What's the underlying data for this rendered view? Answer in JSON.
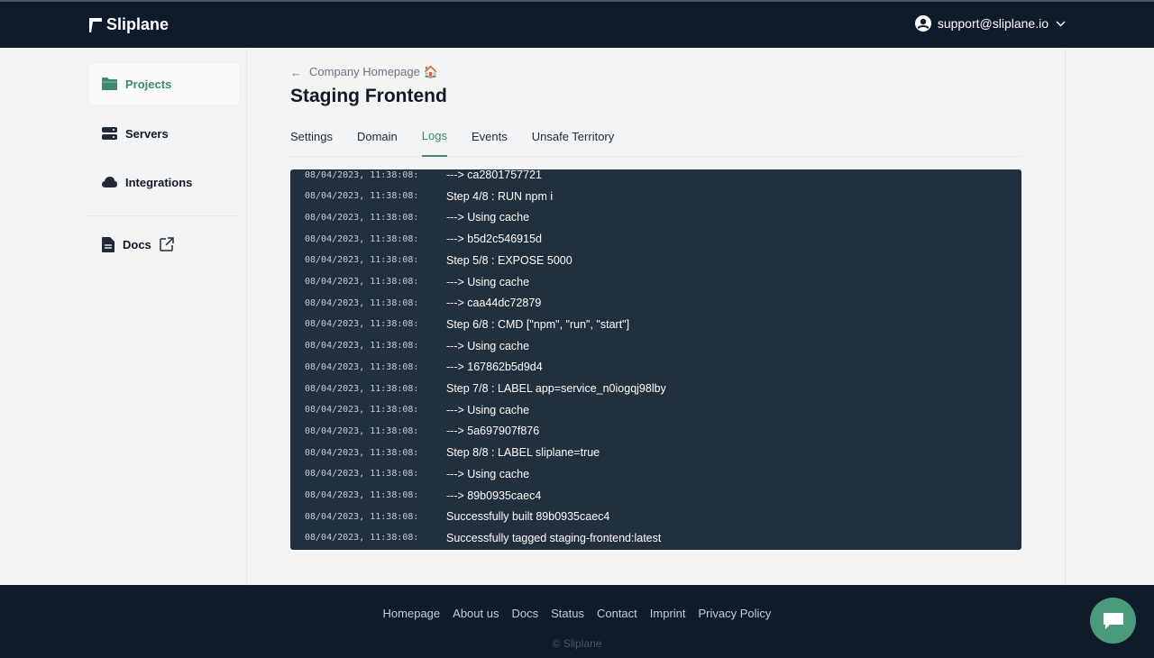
{
  "header": {
    "brand": "Sliplane",
    "user_email": "support@sliplane.io"
  },
  "sidebar": {
    "items": [
      {
        "label": "Projects",
        "icon": "folder-icon",
        "active": true
      },
      {
        "label": "Servers",
        "icon": "server-icon",
        "active": false
      },
      {
        "label": "Integrations",
        "icon": "cloud-icon",
        "active": false
      }
    ],
    "docs": {
      "label": "Docs",
      "icon": "document-icon"
    }
  },
  "main": {
    "breadcrumb": "Company Homepage 🏠",
    "title": "Staging Frontend",
    "tabs": [
      {
        "label": "Settings",
        "active": false
      },
      {
        "label": "Domain",
        "active": false
      },
      {
        "label": "Logs",
        "active": true
      },
      {
        "label": "Events",
        "active": false
      },
      {
        "label": "Unsafe Territory",
        "active": false
      }
    ],
    "logs": [
      {
        "ts": "08/04/2023, 11:38:08:",
        "msg": "---> ca2801757721"
      },
      {
        "ts": "08/04/2023, 11:38:08:",
        "msg": "Step 4/8 : RUN npm i"
      },
      {
        "ts": "08/04/2023, 11:38:08:",
        "msg": "---> Using cache"
      },
      {
        "ts": "08/04/2023, 11:38:08:",
        "msg": "---> b5d2c546915d"
      },
      {
        "ts": "08/04/2023, 11:38:08:",
        "msg": "Step 5/8 : EXPOSE 5000"
      },
      {
        "ts": "08/04/2023, 11:38:08:",
        "msg": "---> Using cache"
      },
      {
        "ts": "08/04/2023, 11:38:08:",
        "msg": "---> caa44dc72879"
      },
      {
        "ts": "08/04/2023, 11:38:08:",
        "msg": "Step 6/8 : CMD [\"npm\", \"run\", \"start\"]"
      },
      {
        "ts": "08/04/2023, 11:38:08:",
        "msg": "---> Using cache"
      },
      {
        "ts": "08/04/2023, 11:38:08:",
        "msg": "---> 167862b5d9d4"
      },
      {
        "ts": "08/04/2023, 11:38:08:",
        "msg": "Step 7/8 : LABEL app=service_n0iogqj98lby"
      },
      {
        "ts": "08/04/2023, 11:38:08:",
        "msg": "---> Using cache"
      },
      {
        "ts": "08/04/2023, 11:38:08:",
        "msg": "---> 5a697907f876"
      },
      {
        "ts": "08/04/2023, 11:38:08:",
        "msg": "Step 8/8 : LABEL sliplane=true"
      },
      {
        "ts": "08/04/2023, 11:38:08:",
        "msg": "---> Using cache"
      },
      {
        "ts": "08/04/2023, 11:38:08:",
        "msg": "---> 89b0935caec4"
      },
      {
        "ts": "08/04/2023, 11:38:08:",
        "msg": "Successfully built 89b0935caec4"
      },
      {
        "ts": "08/04/2023, 11:38:08:",
        "msg": "Successfully tagged staging-frontend:latest"
      }
    ]
  },
  "footer": {
    "links": [
      "Homepage",
      "About us",
      "Docs",
      "Status",
      "Contact",
      "Imprint",
      "Privacy Policy"
    ],
    "copyright": "© Sliplane"
  },
  "colors": {
    "accent": "#3d8a6d",
    "header_bg": "#0f1b2b",
    "log_bg": "#222f3d",
    "chat_bg": "#4a9b7c"
  }
}
